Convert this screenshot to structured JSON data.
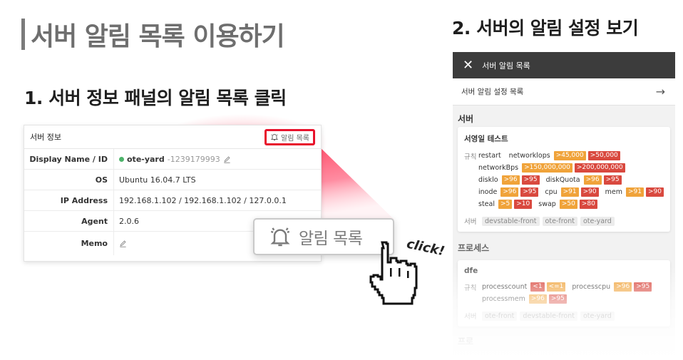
{
  "main_title": "서버 알림 목록 이용하기",
  "step1_title": "1. 서버 정보 패널의 알림 목록 클릭",
  "step2_title": "2. 서버의 알림 설정 보기",
  "server_panel": {
    "title": "서버 정보",
    "alarm_button_label": "알림 목록",
    "rows": {
      "display": {
        "label": "Display Name / ID",
        "name": "ote-yard",
        "id": "-1239179993"
      },
      "os": {
        "label": "OS",
        "value": "Ubuntu 16.04.7 LTS"
      },
      "ip": {
        "label": "IP Address",
        "value": "192.168.1.102 / 192.168.1.102 / 127.0.0.1"
      },
      "agent": {
        "label": "Agent",
        "value": "2.0.6"
      },
      "memo": {
        "label": "Memo",
        "value": ""
      }
    }
  },
  "callout": {
    "label": "알림 목록",
    "click_text": "click!"
  },
  "mobile": {
    "header_title": "서버 알림 목록",
    "settings_link": "서버 알림 설정 목록",
    "section_server": "서버",
    "server_card": {
      "title": "서영일 테스트",
      "rules_label": "규칙",
      "line1": {
        "n1": "restart",
        "n2": "networklops",
        "b1": ">45,000",
        "b2": ">50,000"
      },
      "line2": {
        "n1": "networkBps",
        "b1": ">150,000,000",
        "b2": ">200,000,000"
      },
      "line3": {
        "n1": "disklo",
        "b1": ">96",
        "b2": ">95",
        "n2": "diskQuota",
        "b3": ">96",
        "b4": ">95"
      },
      "line4": {
        "n1": "inode",
        "b1": ">96",
        "b2": ">95",
        "n2": "cpu",
        "b3": ">91",
        "b4": ">90",
        "n3": "mem",
        "b5": ">91",
        "b6": ">90"
      },
      "line5": {
        "n1": "steal",
        "b1": ">5",
        "b2": ">10",
        "n2": "swap",
        "b3": ">50",
        "b4": ">80"
      },
      "servers_label": "서버",
      "tags": [
        "devstable-front",
        "ote-front",
        "ote-yard"
      ]
    },
    "section_process": "프로세스",
    "process_card": {
      "title": "dfe",
      "rules_label": "규칙",
      "line1": {
        "n1": "processcount",
        "b1": "<1",
        "b2": "<=1",
        "n2": "processcpu",
        "b3": ">96",
        "b4": ">95"
      },
      "line2": {
        "n1": "processmem",
        "b1": ">96",
        "b2": ">95"
      },
      "servers_label": "서버",
      "tags": [
        "ote-front",
        "devstable-front",
        "ote-yard"
      ]
    },
    "section_next": "프로"
  }
}
